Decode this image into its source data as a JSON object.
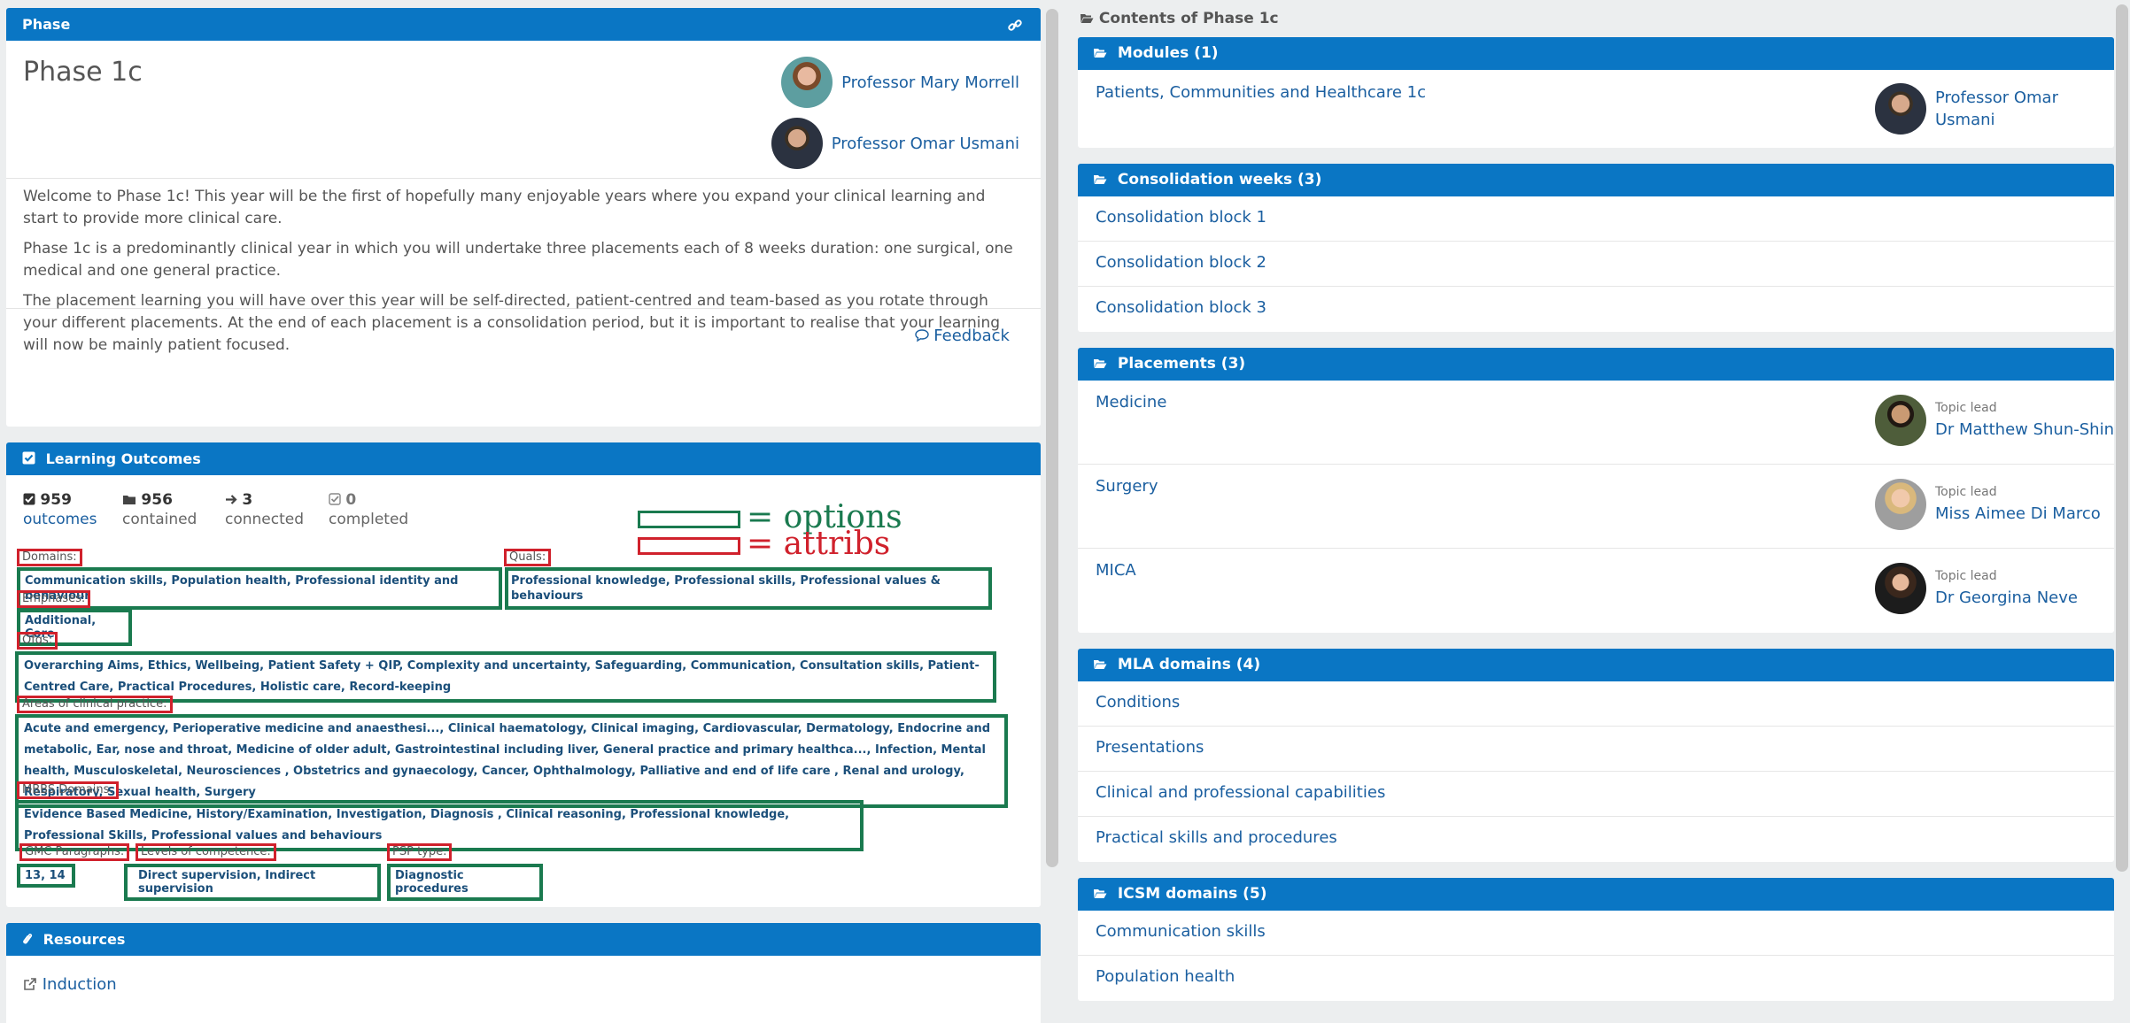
{
  "phase_panel": {
    "header": "Phase",
    "title": "Phase 1c",
    "leads": [
      "Professor Mary Morrell",
      "Professor Omar Usmani"
    ],
    "description": [
      "Welcome to Phase 1c! This year will be the first of hopefully many enjoyable years where you expand your clinical learning and start to provide more clinical care.",
      "Phase 1c is a predominantly clinical year in which you will undertake three placements each of 8 weeks duration: one surgical, one medical and one general practice.",
      "The placement learning you will have over this year will be self-directed, patient-centred and team-based as you rotate through your different placements. At the end of each placement is a consolidation period, but it is important to realise that your learning will now be mainly patient focused."
    ],
    "feedback_label": "Feedback"
  },
  "learning_outcomes": {
    "header": "Learning Outcomes",
    "stats": [
      {
        "num": "959",
        "label": "outcomes"
      },
      {
        "num": "956",
        "label": "contained"
      },
      {
        "num": "3",
        "label": "connected"
      },
      {
        "num": "0",
        "label": "completed"
      }
    ],
    "legend": {
      "options": "= options",
      "attribs": "= attribs"
    },
    "attrs": {
      "domains": "Domains:",
      "quals": "Quals:",
      "emphases": "Emphases:",
      "ofgs": "Ofgs:",
      "areas": "Areas of clinical practice:",
      "mbbs": "MBBS Domains:",
      "gmc": "GMC Paragraphs:",
      "levels": "Levels of competence:",
      "psp": "PSP type:"
    },
    "options": {
      "domains": "Communication skills, Population health, Professional identity and behaviour",
      "quals": "Professional knowledge, Professional skills, Professional values & behaviours",
      "emphases": "Additional, Core",
      "ofgs": "Overarching Aims, Ethics, Wellbeing, Patient Safety + QIP, Complexity and uncertainty, Safeguarding, Communication, Consultation skills, Patient-Centred Care, Practical Procedures, Holistic care, Record-keeping",
      "areas": "Acute and emergency, Perioperative medicine and anaesthesi..., Clinical haematology, Clinical imaging, Cardiovascular, Dermatology, Endocrine and metabolic, Ear, nose and throat, Medicine of older adult, Gastrointestinal including liver, General practice and primary healthca..., Infection, Mental health, Musculoskeletal, Neurosciences , Obstetrics and gynaecology, Cancer, Ophthalmology, Palliative and end of life care , Renal and urology, Respiratory, Sexual health, Surgery",
      "mbbs": "Evidence Based Medicine, History/Examination, Investigation, Diagnosis , Clinical reasoning, Professional knowledge, Professional Skills, Professional values and behaviours",
      "gmc": "13, 14",
      "levels": "Direct supervision, Indirect supervision",
      "psp": "Diagnostic procedures"
    }
  },
  "resources": {
    "header": "Resources",
    "items": [
      "Induction"
    ]
  },
  "contents": {
    "title": "Contents of Phase 1c",
    "modules": {
      "header": "Modules (1)",
      "items": [
        {
          "label": "Patients, Communities and Healthcare 1c",
          "lead": "Professor Omar Usmani"
        }
      ]
    },
    "consolidation": {
      "header": "Consolidation weeks (3)",
      "items": [
        "Consolidation block 1",
        "Consolidation block 2",
        "Consolidation block 3"
      ]
    },
    "placements": {
      "header": "Placements (3)",
      "role": "Topic lead",
      "items": [
        {
          "label": "Medicine",
          "lead": "Dr Matthew Shun-Shin"
        },
        {
          "label": "Surgery",
          "lead": "Miss Aimee Di Marco"
        },
        {
          "label": "MICA",
          "lead": "Dr Georgina Neve"
        }
      ]
    },
    "mla": {
      "header": "MLA domains (4)",
      "items": [
        "Conditions",
        "Presentations",
        "Clinical and professional capabilities",
        "Practical skills and procedures"
      ]
    },
    "icsm": {
      "header": "ICSM domains (5)",
      "items": [
        "Communication skills",
        "Population health"
      ]
    }
  },
  "colors": {
    "header_blue": "#0a76c4",
    "link": "#1b5fa0",
    "attr_red": "#d0212c",
    "option_green": "#1a7a4f"
  },
  "icons": [
    "link-icon",
    "check-square-icon",
    "folder-icon",
    "arrow-right-icon",
    "comment-icon",
    "external-link-icon",
    "paperclip-icon",
    "folder-open-icon"
  ]
}
